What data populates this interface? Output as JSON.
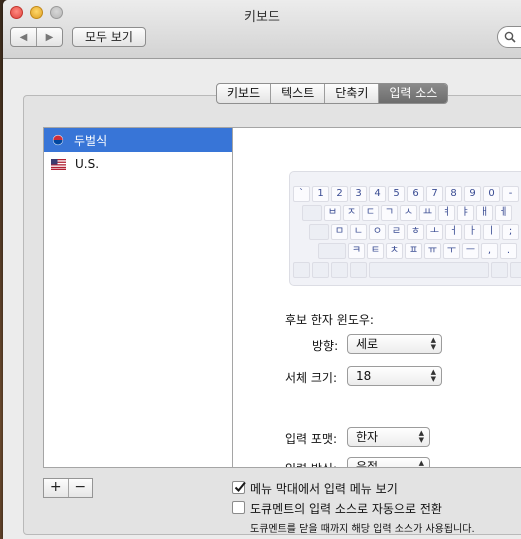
{
  "window": {
    "title": "키보드"
  },
  "toolbar": {
    "show_all": "모두 보기"
  },
  "tabs": [
    {
      "label": "키보드",
      "active": false
    },
    {
      "label": "텍스트",
      "active": false
    },
    {
      "label": "단축키",
      "active": false
    },
    {
      "label": "입력 소스",
      "active": true
    }
  ],
  "sources": [
    {
      "name": "두벌식",
      "icon": "korea-flag-icon",
      "selected": true
    },
    {
      "name": "U.S.",
      "icon": "us-flag-icon",
      "selected": false
    }
  ],
  "list_buttons": {
    "add": "+",
    "remove": "−"
  },
  "keyboard": {
    "row1": [
      "`",
      "1",
      "2",
      "3",
      "4",
      "5",
      "6",
      "7",
      "8",
      "9",
      "0",
      "-"
    ],
    "row2": [
      "ㅂ",
      "ㅈ",
      "ㄷ",
      "ㄱ",
      "ㅅ",
      "ㅛ",
      "ㅕ",
      "ㅑ",
      "ㅐ",
      "ㅔ"
    ],
    "row3": [
      "ㅁ",
      "ㄴ",
      "ㅇ",
      "ㄹ",
      "ㅎ",
      "ㅗ",
      "ㅓ",
      "ㅏ",
      "ㅣ",
      ";"
    ],
    "row4": [
      "ㅋ",
      "ㅌ",
      "ㅊ",
      "ㅍ",
      "ㅠ",
      "ㅜ",
      "ㅡ",
      ",",
      "."
    ]
  },
  "settings": {
    "hanja_window_label": "후보 한자 윈도우:",
    "direction_label": "방향:",
    "direction_value": "세로",
    "font_size_label": "서체 크기:",
    "font_size_value": "18",
    "input_format_label": "입력 포맷:",
    "input_format_value": "한자",
    "input_method_label": "입력 방식:",
    "input_method_value": "음절"
  },
  "options": {
    "show_menu_label": "메뉴 막대에서 입력 메뉴 보기",
    "show_menu_checked": true,
    "auto_switch_label": "도큐멘트의 입력 소스로 자동으로 전환",
    "auto_switch_checked": false,
    "auto_switch_note": "도큐멘트를 닫을 때까지 해당 입력 소스가 사용됩니다."
  },
  "colors": {
    "selection": "#3875d7",
    "key_text": "#3a4c93"
  }
}
